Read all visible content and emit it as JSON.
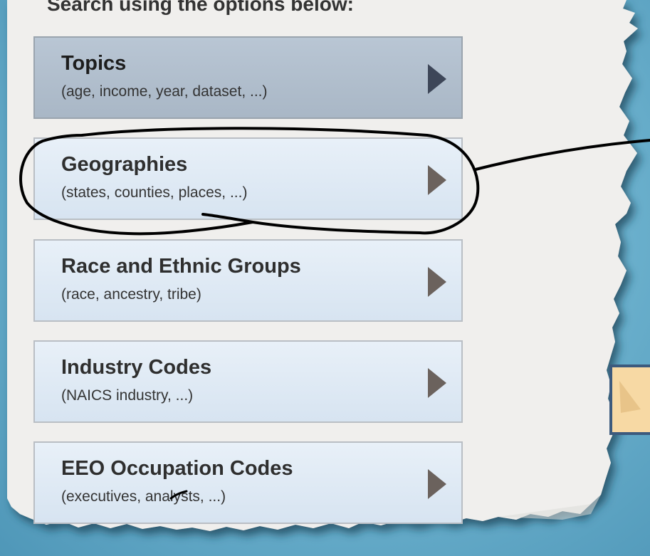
{
  "header": {
    "text": "Search using the options below:"
  },
  "options": [
    {
      "title": "Topics",
      "subtitle": "(age, income, year, dataset, ...)"
    },
    {
      "title": "Geographies",
      "subtitle": "(states, counties, places, ...)"
    },
    {
      "title": "Race and Ethnic Groups",
      "subtitle": "(race, ancestry, tribe)"
    },
    {
      "title": "Industry Codes",
      "subtitle": "(NAICS industry, ...)"
    },
    {
      "title": "EEO Occupation Codes",
      "subtitle": "(executives, analysts, ...)"
    }
  ],
  "colors": {
    "backdrop": "#6fb4d0",
    "panel": "#f0efed",
    "button": "#dde8f3",
    "selected_button": "#b1bfcd",
    "arrow": "#6b625d",
    "selected_arrow": "#3d4658",
    "annotation_ink": "#000000"
  }
}
